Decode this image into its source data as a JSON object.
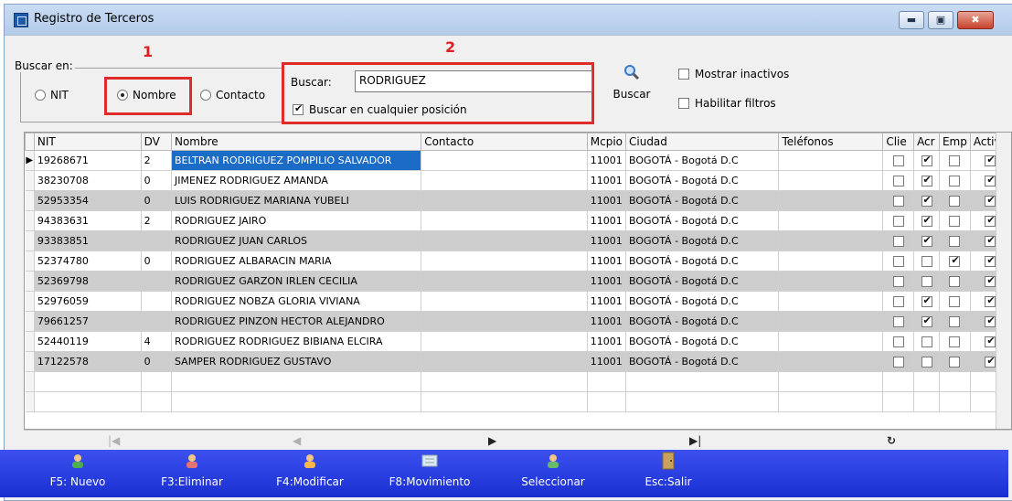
{
  "window": {
    "title": "Registro de Terceros",
    "min_glyph": "▬",
    "max_glyph": "▣",
    "close_glyph": "✖"
  },
  "annotations": {
    "one": "1",
    "two": "2"
  },
  "search_in": {
    "legend": "Buscar en:",
    "nit": "NIT",
    "nombre": "Nombre",
    "contacto": "Contacto",
    "selected": "Nombre"
  },
  "search": {
    "label": "Buscar:",
    "value": "RODRIGUEZ",
    "anywhere_label": "Buscar en cualquier posición",
    "anywhere": true,
    "button": "Buscar"
  },
  "options": {
    "show_inactive": "Mostrar inactivos",
    "show_inactive_checked": false,
    "enable_filters": "Habilitar filtros",
    "enable_filters_checked": false
  },
  "grid": {
    "columns": [
      "NIT",
      "DV",
      "Nombre",
      "Contacto",
      "Mcpio",
      "Ciudad",
      "Teléfonos",
      "Clie",
      "Acr",
      "Emp",
      "Activo"
    ],
    "rows": [
      {
        "nit": "19268671",
        "dv": "2",
        "nombre": "BELTRAN RODRIGUEZ POMPILIO SALVADOR",
        "contacto": "",
        "mcpio": "11001",
        "ciudad": "BOGOTÁ - Bogotá D.C",
        "tel": "",
        "clie": false,
        "acr": true,
        "emp": false,
        "activo": true
      },
      {
        "nit": "38230708",
        "dv": "0",
        "nombre": "JIMENEZ RODRIGUEZ AMANDA",
        "contacto": "",
        "mcpio": "11001",
        "ciudad": "BOGOTÁ - Bogotá D.C",
        "tel": "",
        "clie": false,
        "acr": true,
        "emp": false,
        "activo": true
      },
      {
        "nit": "52953354",
        "dv": "0",
        "nombre": "LUIS RODRIGUEZ MARIANA YUBELI",
        "contacto": "",
        "mcpio": "11001",
        "ciudad": "BOGOTÁ - Bogotá D.C",
        "tel": "",
        "clie": false,
        "acr": true,
        "emp": false,
        "activo": true
      },
      {
        "nit": "94383631",
        "dv": "2",
        "nombre": "RODRIGUEZ  JAIRO",
        "contacto": "",
        "mcpio": "11001",
        "ciudad": "BOGOTÁ - Bogotá D.C",
        "tel": "",
        "clie": false,
        "acr": true,
        "emp": false,
        "activo": true
      },
      {
        "nit": "93383851",
        "dv": "",
        "nombre": "RODRIGUEZ  JUAN CARLOS",
        "contacto": "",
        "mcpio": "11001",
        "ciudad": "BOGOTÁ - Bogotá D.C",
        "tel": "",
        "clie": false,
        "acr": true,
        "emp": false,
        "activo": true
      },
      {
        "nit": "52374780",
        "dv": "0",
        "nombre": "RODRIGUEZ ALBARACIN MARIA",
        "contacto": "",
        "mcpio": "11001",
        "ciudad": "BOGOTÁ - Bogotá D.C",
        "tel": "",
        "clie": false,
        "acr": false,
        "emp": true,
        "activo": true
      },
      {
        "nit": "52369798",
        "dv": "",
        "nombre": "RODRIGUEZ GARZON IRLEN CECILIA",
        "contacto": "",
        "mcpio": "11001",
        "ciudad": "BOGOTÁ - Bogotá D.C",
        "tel": "",
        "clie": false,
        "acr": false,
        "emp": false,
        "activo": true
      },
      {
        "nit": "52976059",
        "dv": "",
        "nombre": "RODRIGUEZ NOBZA GLORIA VIVIANA",
        "contacto": "",
        "mcpio": "11001",
        "ciudad": "BOGOTÁ - Bogotá D.C",
        "tel": "",
        "clie": false,
        "acr": true,
        "emp": false,
        "activo": true
      },
      {
        "nit": "79661257",
        "dv": "",
        "nombre": "RODRIGUEZ PINZON HECTOR ALEJANDRO",
        "contacto": "",
        "mcpio": "11001",
        "ciudad": "BOGOTÁ - Bogotá D.C",
        "tel": "",
        "clie": false,
        "acr": true,
        "emp": false,
        "activo": true
      },
      {
        "nit": "52440119",
        "dv": "4",
        "nombre": "RODRIGUEZ RODRIGUEZ BIBIANA ELCIRA",
        "contacto": "",
        "mcpio": "11001",
        "ciudad": "BOGOTÁ - Bogotá D.C",
        "tel": "",
        "clie": false,
        "acr": false,
        "emp": false,
        "activo": true
      },
      {
        "nit": "17122578",
        "dv": "0",
        "nombre": "SAMPER RODRIGUEZ GUSTAVO",
        "contacto": "",
        "mcpio": "11001",
        "ciudad": "BOGOTÁ - Bogotá D.C",
        "tel": "",
        "clie": false,
        "acr": false,
        "emp": false,
        "activo": true
      }
    ]
  },
  "nav": {
    "first": "|◀",
    "prev": "◀",
    "next": "▶",
    "last": "▶|",
    "refresh": "↻",
    "current_marker": "▶"
  },
  "toolbar": [
    {
      "label": "F5: Nuevo",
      "icon": "user-add-icon"
    },
    {
      "label": "F3:Eliminar",
      "icon": "user-delete-icon"
    },
    {
      "label": "F4:Modificar",
      "icon": "user-edit-icon"
    },
    {
      "label": "F8:Movimiento",
      "icon": "movement-icon"
    },
    {
      "label": "Seleccionar",
      "icon": "user-select-icon"
    },
    {
      "label": "Esc:Salir",
      "icon": "exit-door-icon"
    }
  ],
  "colors": {
    "toolbar": "#2a3fe0",
    "selection": "#1a6cc7",
    "highlight_box": "#e02b2b"
  }
}
